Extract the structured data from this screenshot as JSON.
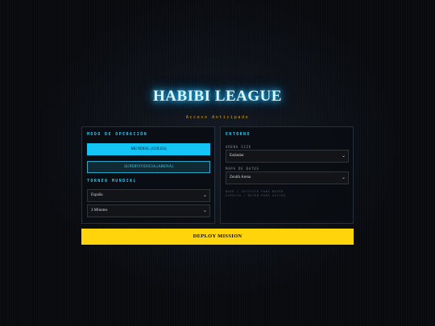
{
  "header": {
    "title": "HABIBI LEAGUE",
    "subtitle": "Acceso Anticipado"
  },
  "left_panel": {
    "mode_title": "MODO DE OPERACIÓN",
    "mode_options": [
      {
        "label": "MUNDIAL (GOLES)",
        "active": true
      },
      {
        "label": "SUPERVIVENCIA (ARENA)",
        "active": false
      }
    ],
    "tournament_title": "TORNEO MUNDIAL",
    "team_select": {
      "value": "España"
    },
    "duration_select": {
      "value": "3 Minutos"
    }
  },
  "right_panel": {
    "title": "ENTORNO",
    "arena_size": {
      "label": "ARENA SIZE",
      "value": "Estándar"
    },
    "map": {
      "label": "MAPA DE DATOS",
      "value": "Zenith Arena"
    },
    "hint_lines": [
      "WASD / JOYSTICK PARA MOVER",
      "ESPACIO / BOTÓN PARA SALTAR"
    ]
  },
  "deploy_button": {
    "label": "DEPLOY MISSION"
  },
  "colors": {
    "accent_cyan": "#14c4f4",
    "accent_yellow": "#ffd40a",
    "subtitle_gold": "#e2a316",
    "background": "#080a0e"
  },
  "icons": {
    "select_chevron": "chevron-down-icon"
  }
}
